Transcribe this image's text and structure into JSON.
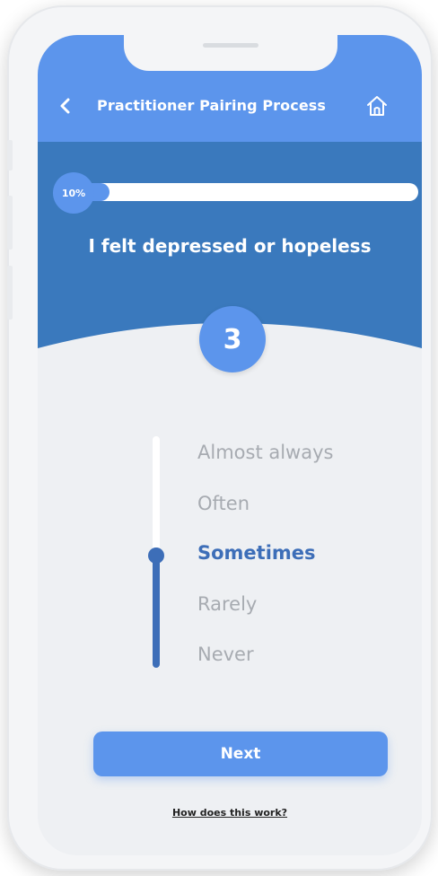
{
  "header": {
    "title": "Practitioner Pairing Process",
    "back_icon": "chevron-left-icon",
    "home_icon": "home-icon"
  },
  "progress": {
    "label": "10%",
    "value": 10
  },
  "question": {
    "text": "I felt depressed or hopeless"
  },
  "score": {
    "value": "3"
  },
  "options": [
    {
      "label": "Almost always"
    },
    {
      "label": "Often"
    },
    {
      "label": "Sometimes"
    },
    {
      "label": "Rarely"
    },
    {
      "label": "Never"
    }
  ],
  "selected_option_index": 2,
  "footer": {
    "next_label": "Next",
    "help_link": "How does this work?"
  },
  "colors": {
    "primary": "#5c95ec",
    "hero_background": "#3a79bd",
    "selected_text": "#3d6eb8",
    "unselected_text": "#a7abb1",
    "screen_background": "#eef0f3"
  }
}
